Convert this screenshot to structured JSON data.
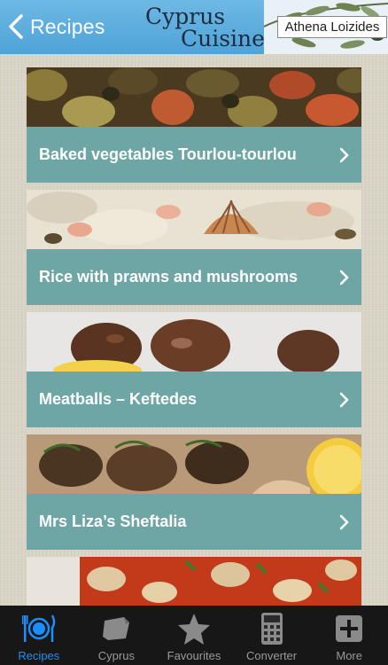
{
  "header": {
    "back_label": "Recipes",
    "logo_line1": "Cyprus",
    "logo_line2": "Cuisine",
    "author": "Athena Loizides"
  },
  "recipes": [
    {
      "title": "Baked vegetables Tourlou-tourlou",
      "photo": "baked-vegetables-photo"
    },
    {
      "title": "Rice with prawns and mushrooms",
      "photo": "rice-prawns-photo"
    },
    {
      "title": "Meatballs – Keftedes",
      "photo": "meatballs-photo"
    },
    {
      "title": "Mrs Liza’s Sheftalia",
      "photo": "sheftalia-photo"
    },
    {
      "title": "",
      "photo": "beans-stew-photo"
    }
  ],
  "tabbar": {
    "active": "Recipes",
    "tabs": [
      {
        "label": "Recipes",
        "icon": "plate-cutlery-icon"
      },
      {
        "label": "Cyprus",
        "icon": "cyprus-map-icon"
      },
      {
        "label": "Favourites",
        "icon": "star-icon"
      },
      {
        "label": "Converter",
        "icon": "calculator-icon"
      },
      {
        "label": "More",
        "icon": "plus-icon"
      }
    ]
  },
  "colors": {
    "header": "#4fa3d8",
    "bar": "#6ea6a6",
    "tab_active": "#1a8fff",
    "tab_inactive": "#9a9a9a"
  }
}
